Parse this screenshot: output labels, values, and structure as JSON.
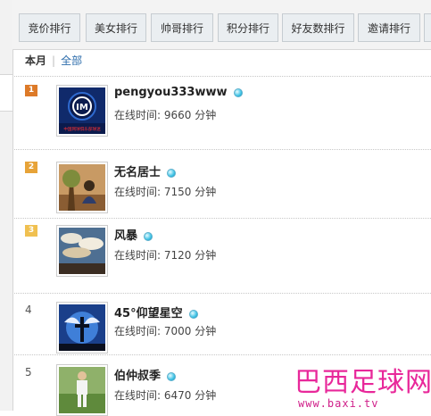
{
  "tabs": [
    {
      "label": "竞价排行"
    },
    {
      "label": "美女排行"
    },
    {
      "label": "帅哥排行"
    },
    {
      "label": "积分排行"
    },
    {
      "label": "好友数排行"
    },
    {
      "label": "邀请排行"
    }
  ],
  "filter": {
    "current": "本月",
    "separator": "|",
    "all": "全部"
  },
  "colors": {
    "badge_1": "#dd7a28",
    "badge_2": "#e7a338",
    "badge_3": "#f0c050",
    "link": "#2c6cab",
    "watermark": "#e8289a"
  },
  "ranking": [
    {
      "rank": "1",
      "name": "pengyou333www",
      "time": "在线时间: 9660 分钟",
      "avatar_icon": "inter-milan-logo",
      "avatar_caption": "中国网球俱乐部球迷"
    },
    {
      "rank": "2",
      "name": "无名居士",
      "time": "在线时间: 7150 分钟",
      "avatar_icon": "boy-under-tree"
    },
    {
      "rank": "3",
      "name": "风暴",
      "time": "在线时间: 7120 分钟",
      "avatar_icon": "cloudy-sky"
    },
    {
      "rank": "4",
      "name": "45°仰望星空",
      "time": "在线时间: 7000 分钟",
      "avatar_icon": "angel-cross"
    },
    {
      "rank": "5",
      "name": "伯仲叔季",
      "time": "在线时间: 6470 分钟",
      "avatar_icon": "football-player"
    }
  ],
  "watermark": {
    "title": "巴西足球网",
    "url": "www.baxi.tv"
  }
}
